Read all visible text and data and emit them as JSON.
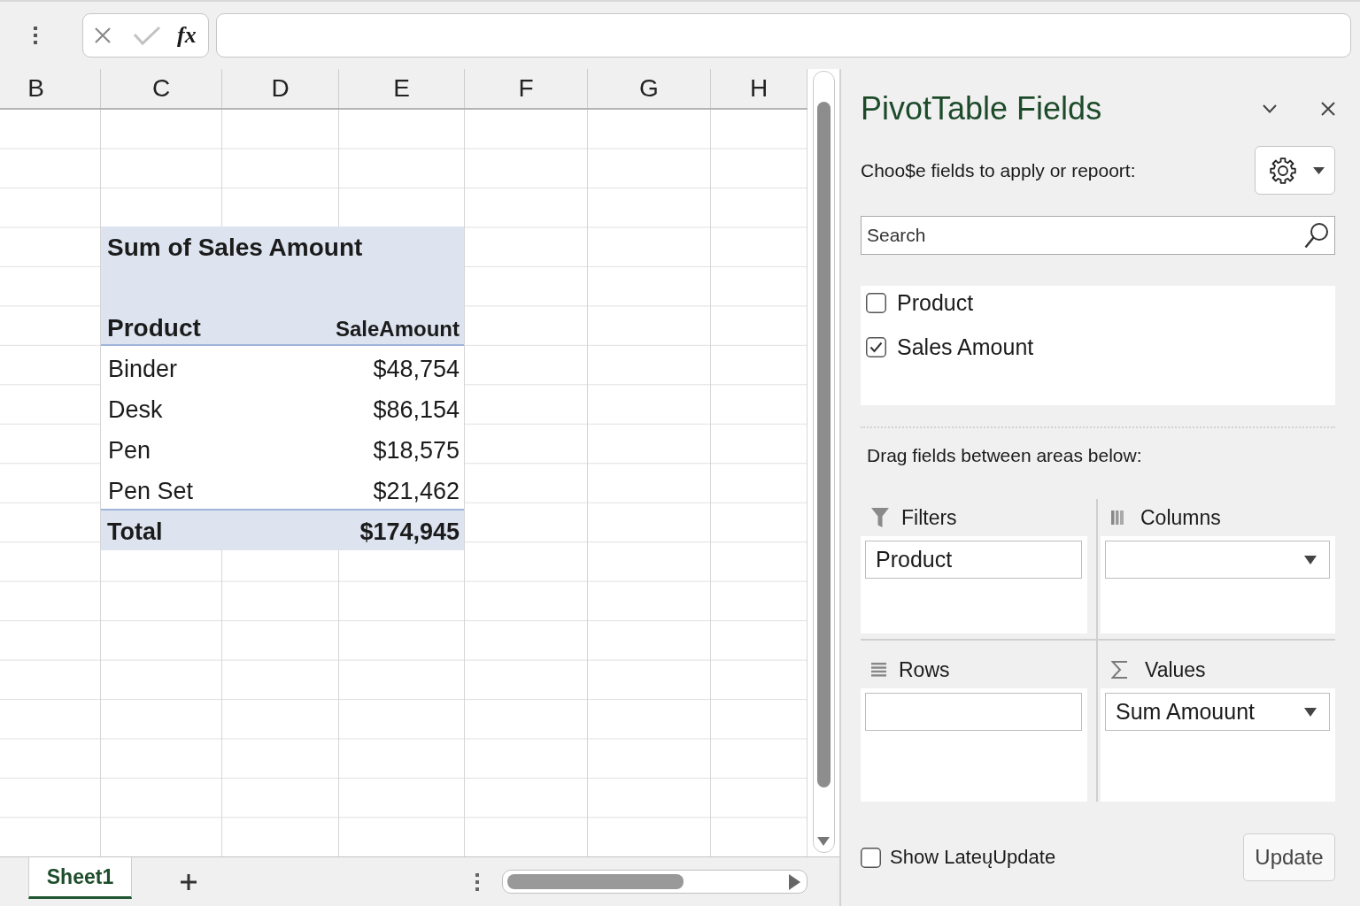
{
  "formula_bar": {
    "function_button": "fx"
  },
  "sheet": {
    "columns": [
      "B",
      "C",
      "D",
      "E",
      "F",
      "G",
      "H"
    ],
    "pivot_table": {
      "title": "Sum of Sales Amount",
      "headers": [
        "Product",
        "SaleAmount"
      ],
      "rows": [
        {
          "product": "Binder",
          "amount": "$48,754"
        },
        {
          "product": "Desk",
          "amount": "$86,154"
        },
        {
          "product": "Pen",
          "amount": "$18,575"
        },
        {
          "product": "Pen Set",
          "amount": "$21,462"
        }
      ],
      "total": {
        "label": "Total",
        "amount": "$174,945"
      }
    }
  },
  "sheet_tabs": [
    {
      "label": "Sheet1",
      "selected": true
    }
  ],
  "task_pane": {
    "title": "PivotTable Fields",
    "prompt": "Choo$e fields to apply or repoort:",
    "search": {
      "placeholder": "Search"
    },
    "fields": [
      {
        "label": "Product",
        "checked": false
      },
      {
        "label": "Sales Amount",
        "checked": true
      }
    ],
    "areas_prompt": "Drag fields between areas below:",
    "areas": [
      {
        "kind": "filters",
        "title": "Filters",
        "items": [
          {
            "label": "Product",
            "dropdown": false
          }
        ]
      },
      {
        "kind": "columns",
        "title": "Columns",
        "items": [
          {
            "dropdown": true
          }
        ]
      },
      {
        "kind": "rows",
        "title": "Rows",
        "items": [
          {
            "dropdown": false
          }
        ]
      },
      {
        "kind": "values",
        "title": "Values",
        "items": [
          {
            "label": "Sum Amouunt",
            "dropdown": true
          }
        ]
      }
    ],
    "defer_update": {
      "label": "Show LateųUpdate",
      "checked": false
    },
    "update_button": "Update"
  }
}
